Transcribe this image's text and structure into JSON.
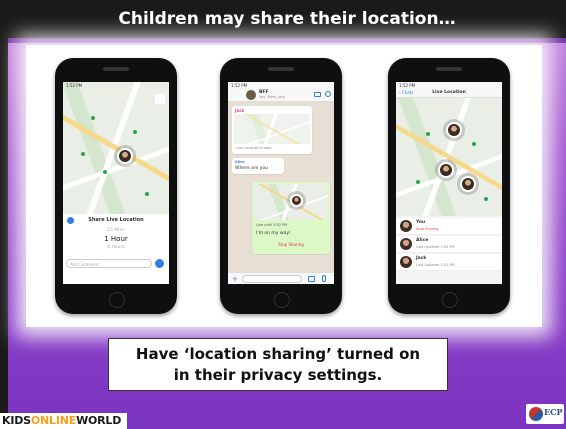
{
  "slide": {
    "title": "Children may share their location…",
    "caption_line1": "Have ‘location sharing’ turned on",
    "caption_line2": "in their privacy settings."
  },
  "phones": {
    "phone1": {
      "status_time": "1:52 PM",
      "sheet_title": "Share Live Location",
      "options": [
        "15 Mins",
        "1 Hour",
        "8 Hours"
      ],
      "selected": "1 Hour",
      "comment_placeholder": "Add Comment"
    },
    "phone2": {
      "status_time": "1:52 PM",
      "chat_name": "BFF",
      "chat_sub": "You, Mom, Jack",
      "sender1": "Jack",
      "live_location_ended": "Live Location Ended",
      "sender2": "Alice",
      "message": "Where are you",
      "live_until": "Live until 2:52 PM",
      "reply": "I'm on my way!",
      "stop_sharing": "Stop Sharing"
    },
    "phone3": {
      "status_time": "1:52 PM",
      "back_label": "Chats",
      "header_title": "Live Location",
      "rows": [
        {
          "name": "You",
          "sub": "Stop Sharing"
        },
        {
          "name": "Alice",
          "sub": "Last Updated 1:50 PM"
        },
        {
          "name": "Jack",
          "sub": "Last Updated 1:52 PM"
        }
      ]
    }
  },
  "logos": {
    "kids_prefix": "KIDS",
    "kids_highlight": "ONLINE",
    "kids_suffix": "WORLD",
    "ecp": "ECP"
  },
  "colors": {
    "title_bar": "#1a1a1a",
    "gradient_top": "#c98ee0",
    "gradient_bottom": "#7b34c0",
    "whatsapp_green": "#dcf8c6",
    "map_dot": "#2fa34f"
  }
}
